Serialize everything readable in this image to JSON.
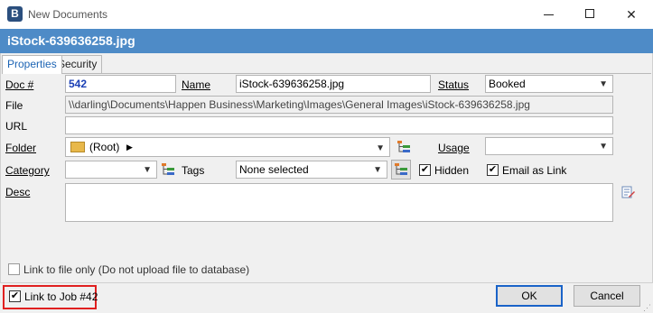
{
  "window": {
    "title": "New Documents",
    "app_icon_letter": "B"
  },
  "header": {
    "title": "iStock-639636258.jpg"
  },
  "tabs": [
    {
      "label": "Properties"
    },
    {
      "label": "Security"
    }
  ],
  "form": {
    "doc_label": "Doc #",
    "doc_value": "542",
    "name_label": "Name",
    "name_value": "iStock-639636258.jpg",
    "status_label": "Status",
    "status_value": "Booked",
    "file_label": "File",
    "file_value": "\\\\darling\\Documents\\Happen Business\\Marketing\\Images\\General Images\\iStock-639636258.jpg",
    "url_label": "URL",
    "url_value": "",
    "folder_label": "Folder",
    "folder_value": "(Root)",
    "usage_label": "Usage",
    "usage_value": "",
    "category_label": "Category",
    "category_value": "",
    "tags_label": "Tags",
    "tags_value": "None selected",
    "hidden_label": "Hidden",
    "hidden_checked": true,
    "email_link_label": "Email as Link",
    "email_link_checked": true,
    "desc_label": "Desc",
    "desc_value": "",
    "link_file_only_label": "Link to file only (Do not upload file to database)",
    "link_file_only_checked": false
  },
  "footer": {
    "link_job_label": "Link to Job #42",
    "link_job_checked": true,
    "ok_label": "OK",
    "cancel_label": "Cancel"
  },
  "icons": {
    "minimize": "minimize-icon",
    "maximize": "maximize-icon",
    "close": "close-icon",
    "folder": "folder-icon",
    "tree": "tree-icon",
    "edit": "edit-icon",
    "check": "✔"
  },
  "colors": {
    "header": "#4e8bc7",
    "highlight": "#e02020",
    "ok_border": "#1a63c8"
  }
}
